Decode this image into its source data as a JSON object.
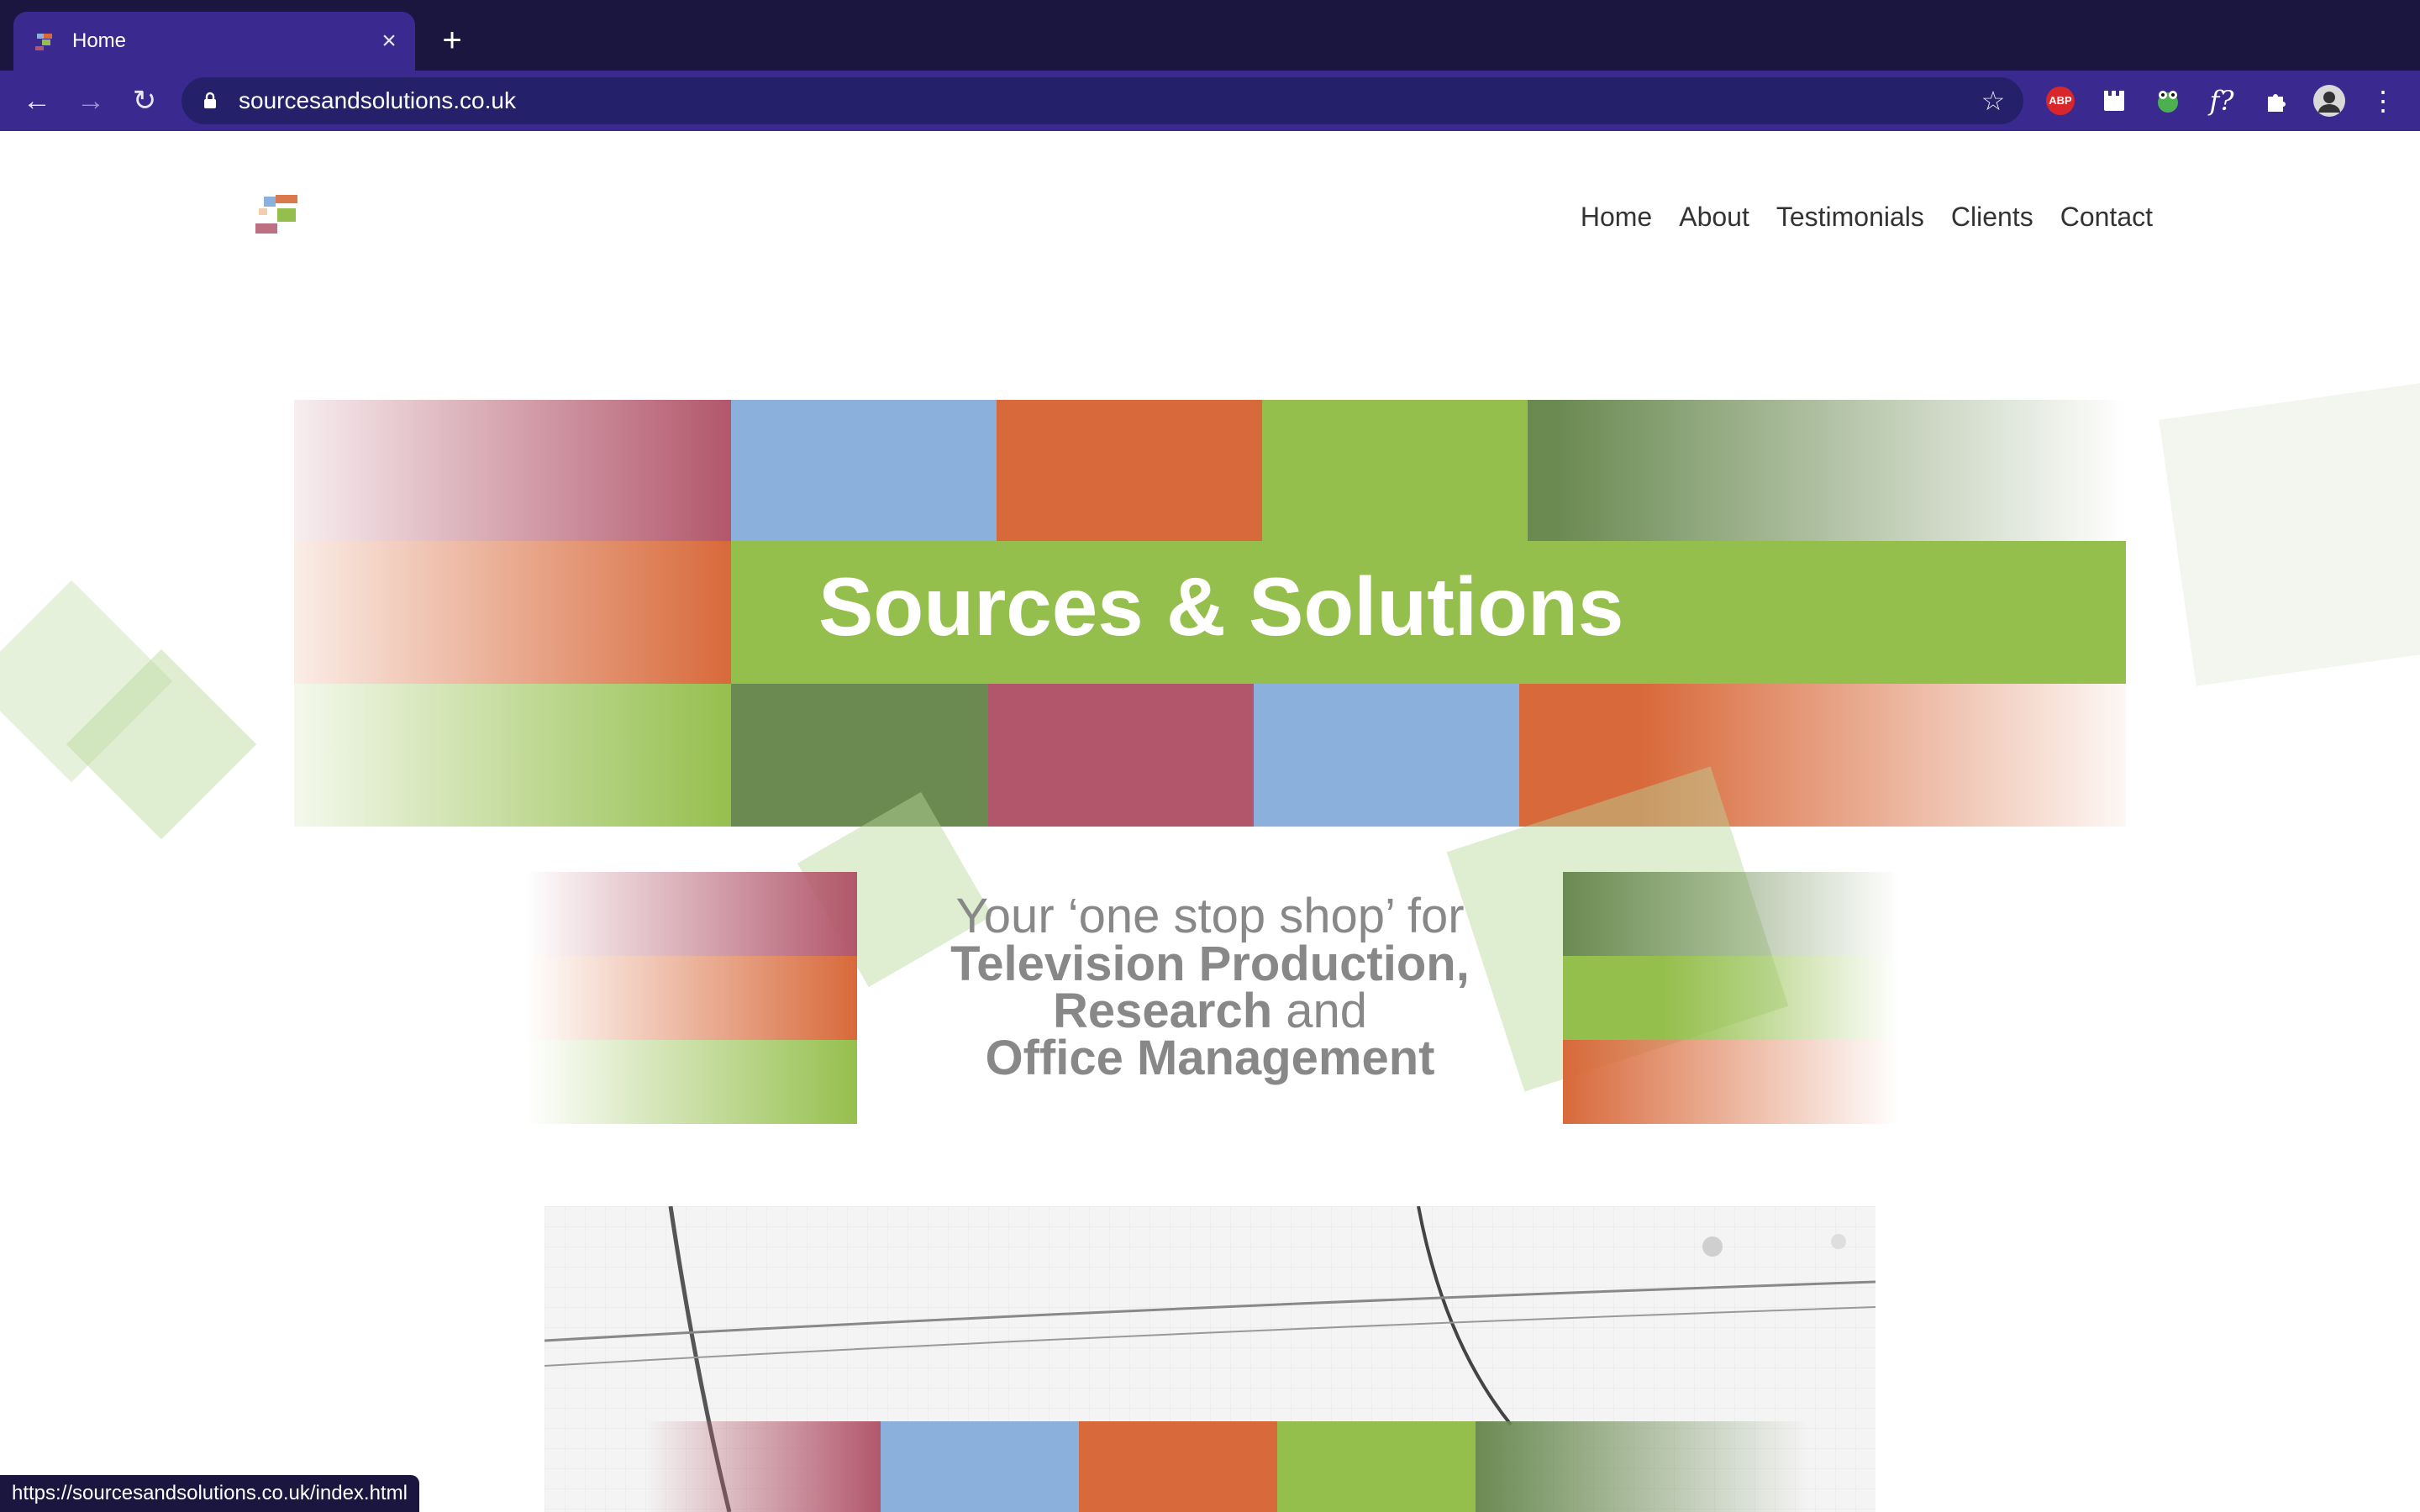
{
  "browser": {
    "tab_title": "Home",
    "url": "sourcesandsolutions.co.uk",
    "status_url": "https://sourcesandsolutions.co.uk/index.html",
    "extensions": [
      "abp-icon",
      "clapperboard-icon",
      "frog-icon",
      "font-finder-icon",
      "puzzle-icon",
      "profile-avatar"
    ],
    "abp_label": "ABP",
    "font_ext_label": "f?"
  },
  "site": {
    "nav": [
      "Home",
      "About",
      "Testimonials",
      "Clients",
      "Contact"
    ],
    "hero_title": "Sources & Solutions",
    "tagline": {
      "line1": "Your ‘one stop shop’ for",
      "line2": "Television Production,",
      "line3_bold": "Research",
      "line3_rest": " and",
      "line4": "Office Management"
    }
  },
  "colors": {
    "brand_green": "#95bf4d",
    "brand_blue": "#8bb0dc",
    "brand_orange": "#d8693a",
    "brand_dark_green": "#6b8a52",
    "brand_rose": "#b2576b",
    "browser_purple": "#3a2a90",
    "browser_dark": "#1b1640"
  }
}
